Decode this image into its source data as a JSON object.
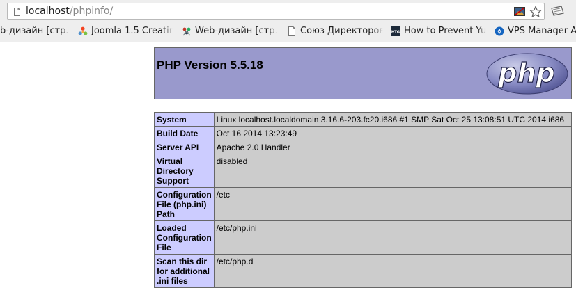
{
  "browser": {
    "url_host": "localhost",
    "url_path": "/phpinfo/",
    "bookmarks": [
      {
        "label": "b-дизайн [стр.",
        "icon": "none"
      },
      {
        "label": "Joomla 1.5 Creatin",
        "icon": "joomla-icon"
      },
      {
        "label": "Web-дизайн [стр.",
        "icon": "web-design-icon"
      },
      {
        "label": "Союз Директоров",
        "icon": "document-icon"
      },
      {
        "label": "How to Prevent Yu",
        "icon": "htg-icon",
        "icon_text": "HTG"
      },
      {
        "label": "VPS Manager A",
        "icon": "vps-icon"
      }
    ]
  },
  "php": {
    "title": "PHP Version 5.5.18",
    "logo_text": "php"
  },
  "info_rows": [
    {
      "key": "System",
      "value": "Linux localhost.localdomain 3.16.6-203.fc20.i686 #1 SMP Sat Oct 25 13:08:51 UTC 2014 i686"
    },
    {
      "key": "Build Date",
      "value": "Oct 16 2014 13:23:49"
    },
    {
      "key": "Server API",
      "value": "Apache 2.0 Handler"
    },
    {
      "key": "Virtual Directory Support",
      "value": "disabled"
    },
    {
      "key": "Configuration File (php.ini) Path",
      "value": "/etc"
    },
    {
      "key": "Loaded Configuration File",
      "value": "/etc/php.ini"
    },
    {
      "key": "Scan this dir for additional .ini files",
      "value": "/etc/php.d"
    }
  ],
  "colors": {
    "header_bg": "#9999cc",
    "key_bg": "#ccccff",
    "value_bg": "#cccccc",
    "border": "#666666"
  }
}
